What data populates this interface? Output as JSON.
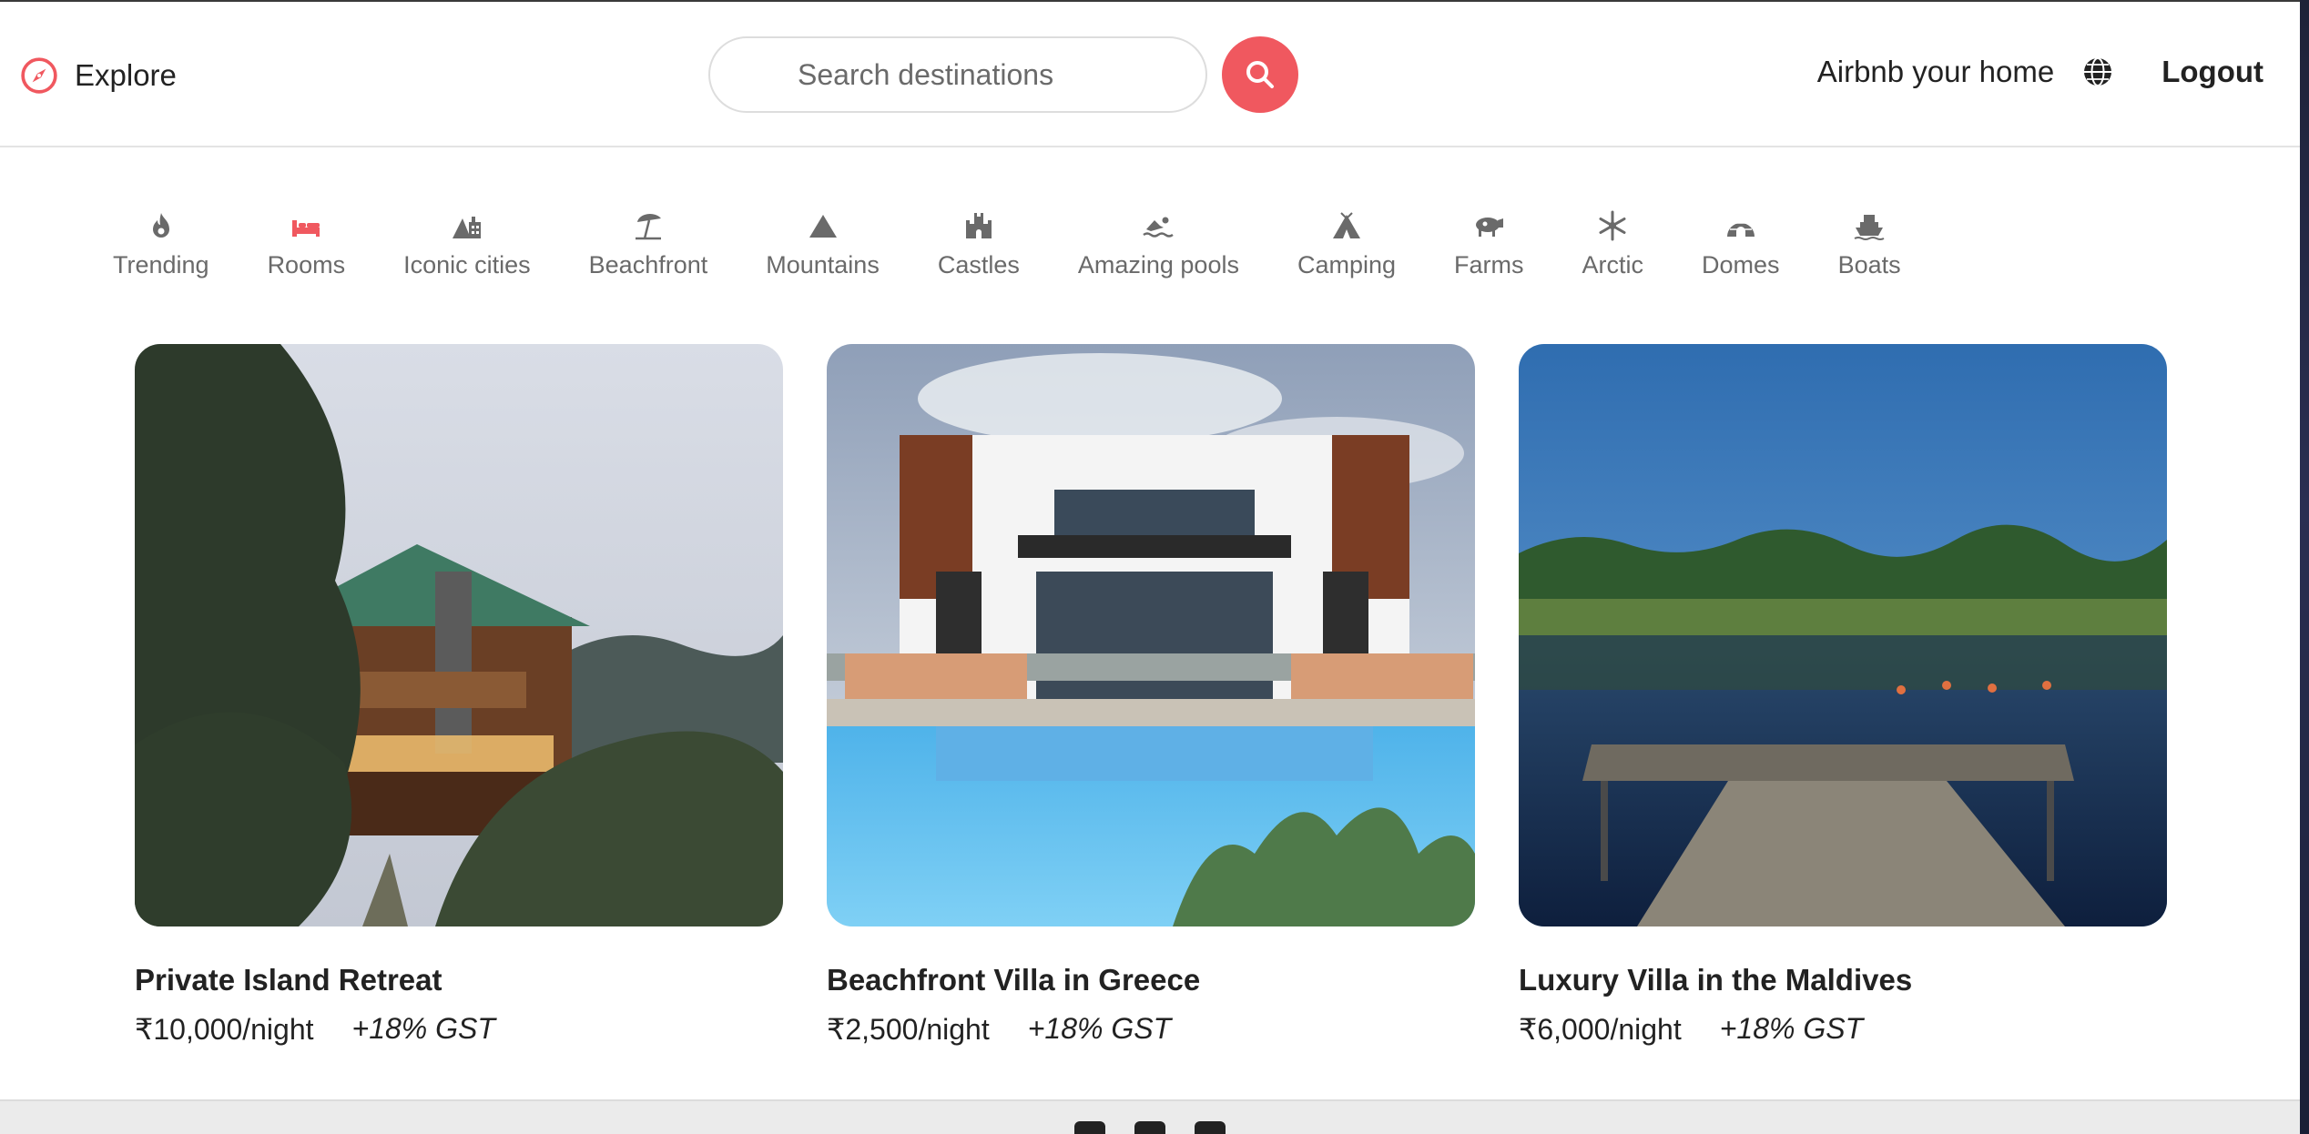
{
  "navbar": {
    "brand_label": "Explore",
    "brand_icon": "compass-icon",
    "search_placeholder": "Search destinations",
    "search_value": "",
    "host_link": "Airbnb your home",
    "globe_icon": "globe-icon",
    "logout_label": "Logout",
    "accent_color": "#f0585f"
  },
  "categories": [
    {
      "label": "Trending",
      "icon": "fire-icon",
      "active": false
    },
    {
      "label": "Rooms",
      "icon": "bed-icon",
      "active": true
    },
    {
      "label": "Iconic cities",
      "icon": "city-icon",
      "active": false
    },
    {
      "label": "Beachfront",
      "icon": "umbrella-icon",
      "active": false
    },
    {
      "label": "Mountains",
      "icon": "mountain-icon",
      "active": false
    },
    {
      "label": "Castles",
      "icon": "castle-icon",
      "active": false
    },
    {
      "label": "Amazing pools",
      "icon": "swimmer-icon",
      "active": false
    },
    {
      "label": "Camping",
      "icon": "tent-icon",
      "active": false
    },
    {
      "label": "Farms",
      "icon": "cow-icon",
      "active": false
    },
    {
      "label": "Arctic",
      "icon": "snowflake-icon",
      "active": false
    },
    {
      "label": "Domes",
      "icon": "igloo-icon",
      "active": false
    },
    {
      "label": "Boats",
      "icon": "ship-icon",
      "active": false
    }
  ],
  "listings": [
    {
      "title": "Private Island Retreat",
      "price": "₹10,000/night",
      "tax": "+18% GST"
    },
    {
      "title": "Beachfront Villa in Greece",
      "price": "₹2,500/night",
      "tax": "+18% GST"
    },
    {
      "title": "Luxury Villa in the Maldives",
      "price": "₹6,000/night",
      "tax": "+18% GST"
    }
  ],
  "footer": {
    "social_icons": [
      "facebook-icon",
      "instagram-icon",
      "linkedin-icon"
    ]
  }
}
